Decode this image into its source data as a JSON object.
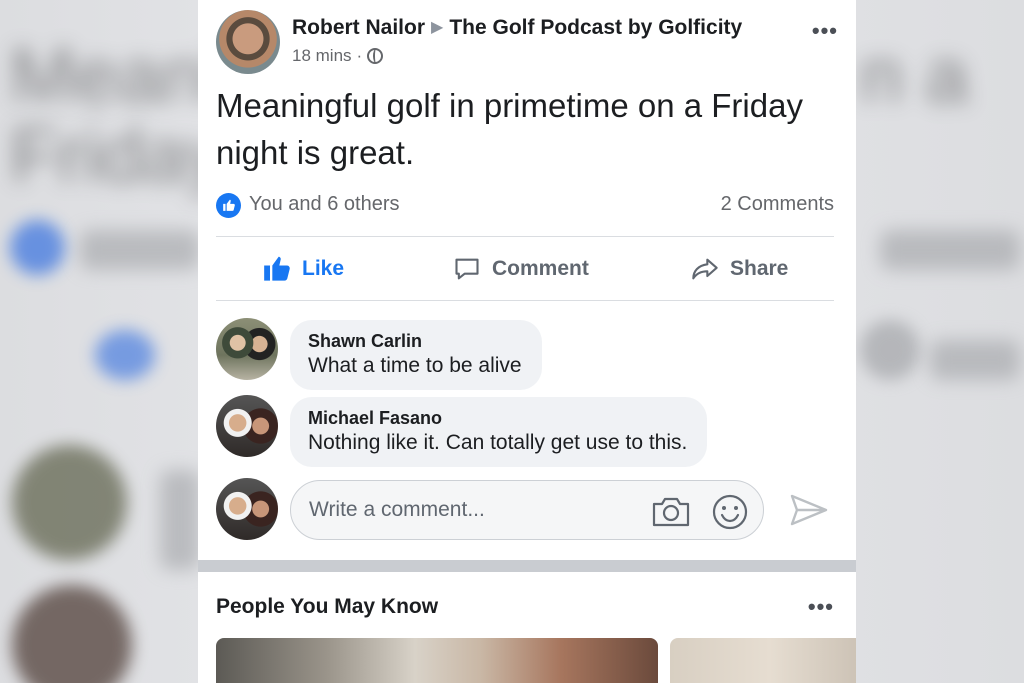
{
  "post": {
    "author": "Robert Nailor",
    "target": "The Golf Podcast by Golficity",
    "time": "18 mins",
    "time_sep": "·",
    "more": "•••",
    "text": "Meaningful golf in primetime on a Friday night is great.",
    "reactions": "You and 6 others",
    "comment_count": "2 Comments"
  },
  "actions": {
    "like": "Like",
    "comment": "Comment",
    "share": "Share"
  },
  "comments": [
    {
      "name": "Shawn Carlin",
      "text": "What a time to be alive"
    },
    {
      "name": "Michael Fasano",
      "text": "Nothing like it.  Can totally get use to this."
    }
  ],
  "composer": {
    "placeholder": "Write a comment..."
  },
  "pymk": {
    "title": "People You May Know",
    "more": "•••"
  },
  "background": {
    "blur_1": "Meani",
    "blur_2": "Friday",
    "blur_3": "n a"
  },
  "colors": {
    "accent": "#1877f2",
    "text": "#1c1e21",
    "muted": "#65676b"
  },
  "icons": [
    "globe-icon",
    "more-icon",
    "like-icon",
    "comment-icon",
    "share-icon",
    "camera-icon",
    "emoji-icon",
    "send-icon"
  ]
}
